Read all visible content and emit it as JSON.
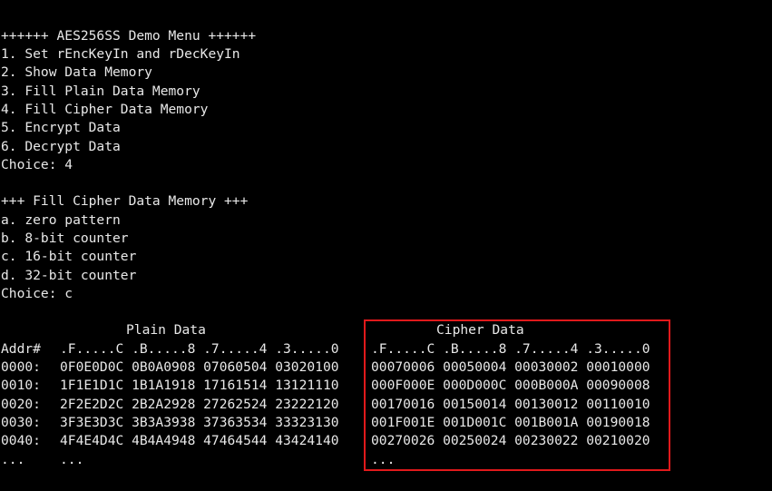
{
  "menu": {
    "title": "++++++ AES256SS Demo Menu ++++++",
    "items": [
      "1. Set rEncKeyIn and rDecKeyIn",
      "2. Show Data Memory",
      "3. Fill Plain Data Memory",
      "4. Fill Cipher Data Memory",
      "5. Encrypt Data",
      "6. Decrypt Data"
    ],
    "choice": "Choice: 4"
  },
  "submenu": {
    "title": "+++ Fill Cipher Data Memory +++",
    "items": [
      "a. zero pattern",
      "b. 8-bit counter",
      "c. 16-bit counter",
      "d. 32-bit counter"
    ],
    "choice": "Choice: c"
  },
  "memory_table": {
    "plain_header": "Plain Data",
    "cipher_header": "Cipher Data",
    "addr_col_header": "Addr#",
    "plain_col_header": ".F.....C .B.....8 .7.....4 .3.....0",
    "cipher_col_header": ".F.....C .B.....8 .7.....4 .3.....0",
    "rows": [
      {
        "addr": "0000:",
        "plain": "0F0E0D0C 0B0A0908 07060504 03020100",
        "cipher": "00070006 00050004 00030002 00010000"
      },
      {
        "addr": "0010:",
        "plain": "1F1E1D1C 1B1A1918 17161514 13121110",
        "cipher": "000F000E 000D000C 000B000A 00090008"
      },
      {
        "addr": "0020:",
        "plain": "2F2E2D2C 2B2A2928 27262524 23222120",
        "cipher": "00170016 00150014 00130012 00110010"
      },
      {
        "addr": "0030:",
        "plain": "3F3E3D3C 3B3A3938 37363534 33323130",
        "cipher": "001F001E 001D001C 001B001A 00190018"
      },
      {
        "addr": "0040:",
        "plain": "4F4E4D4C 4B4A4948 47464544 43424140",
        "cipher": "00270026 00250024 00230022 00210020"
      },
      {
        "addr": "...",
        "plain": "...",
        "cipher": "..."
      }
    ]
  },
  "colors": {
    "background": "#000000",
    "text": "#e8e8e8",
    "highlight_box": "#e0191b"
  }
}
